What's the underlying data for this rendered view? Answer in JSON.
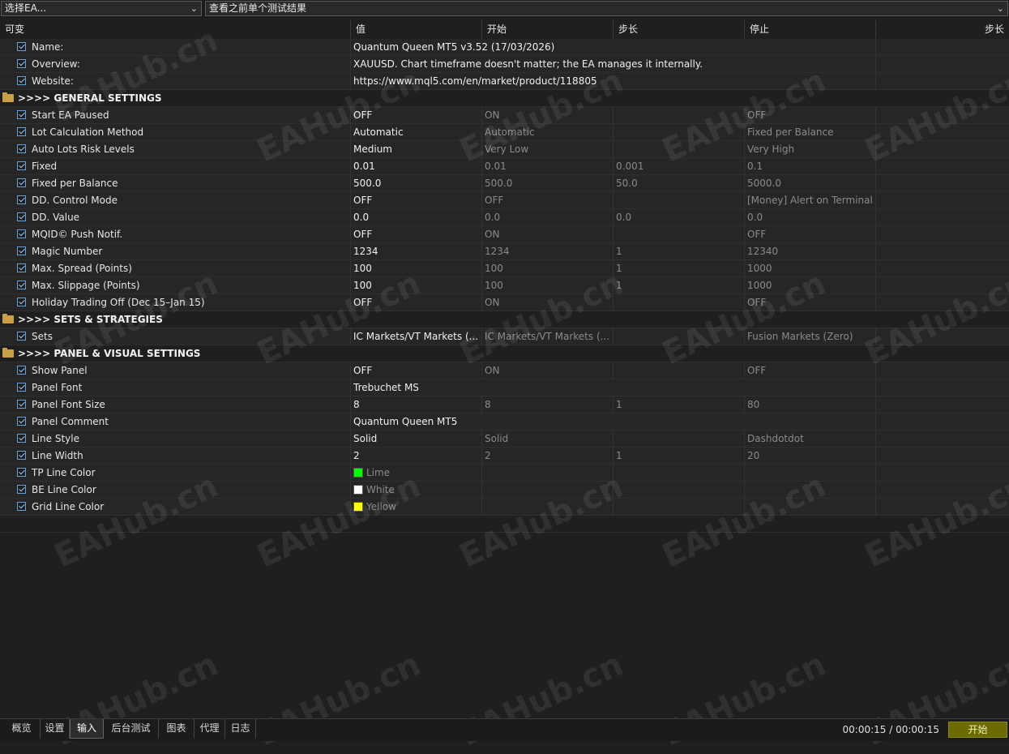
{
  "toolbar": {
    "ea_select": "选择EA...",
    "results_select": "查看之前单个测试结果"
  },
  "columns": [
    "可变",
    "值",
    "开始",
    "步长",
    "停止",
    "步长"
  ],
  "rows": [
    {
      "type": "param",
      "name": "Name:",
      "wide": "Quantum Queen MT5 v3.52 (17/03/2026)"
    },
    {
      "type": "param",
      "name": "Overview:",
      "wide": "XAUUSD. Chart timeframe doesn't matter; the EA manages it internally."
    },
    {
      "type": "param",
      "name": "Website:",
      "wide": "https://www.mql5.com/en/market/product/118805"
    },
    {
      "type": "section",
      "name": ">>>> GENERAL SETTINGS"
    },
    {
      "type": "param",
      "name": "Start EA Paused",
      "value": "OFF",
      "start": "ON",
      "step": "",
      "stop": "OFF"
    },
    {
      "type": "param",
      "name": "Lot Calculation Method",
      "value": "Automatic",
      "start": "Automatic",
      "step": "",
      "stop": "Fixed per Balance"
    },
    {
      "type": "param",
      "name": "Auto Lots Risk Levels",
      "value": "Medium",
      "start": "Very Low",
      "step": "",
      "stop": "Very High"
    },
    {
      "type": "param",
      "name": "Fixed",
      "value": "0.01",
      "start": "0.01",
      "step": "0.001",
      "stop": "0.1"
    },
    {
      "type": "param",
      "name": "Fixed per Balance",
      "value": "500.0",
      "start": "500.0",
      "step": "50.0",
      "stop": "5000.0"
    },
    {
      "type": "param",
      "name": "DD. Control Mode",
      "value": "OFF",
      "start": "OFF",
      "step": "",
      "stop": "[Money] Alert on Terminal"
    },
    {
      "type": "param",
      "name": "DD. Value",
      "value": "0.0",
      "start": "0.0",
      "step": "0.0",
      "stop": "0.0"
    },
    {
      "type": "param",
      "name": "MQID© Push Notif.",
      "value": "OFF",
      "start": "ON",
      "step": "",
      "stop": "OFF"
    },
    {
      "type": "param",
      "name": "Magic Number",
      "value": "1234",
      "start": "1234",
      "step": "1",
      "stop": "12340"
    },
    {
      "type": "param",
      "name": "Max. Spread (Points)",
      "value": "100",
      "start": "100",
      "step": "1",
      "stop": "1000"
    },
    {
      "type": "param",
      "name": "Max. Slippage (Points)",
      "value": "100",
      "start": "100",
      "step": "1",
      "stop": "1000"
    },
    {
      "type": "param",
      "name": "Holiday Trading Off (Dec 15–Jan 15)",
      "value": "OFF",
      "start": "ON",
      "step": "",
      "stop": "OFF"
    },
    {
      "type": "section",
      "name": ">>>> SETS & STRATEGIES"
    },
    {
      "type": "param",
      "name": "Sets",
      "value": "IC Markets/VT Markets (...",
      "start": "IC Markets/VT Markets (...",
      "step": "",
      "stop": "Fusion Markets (Zero)"
    },
    {
      "type": "section",
      "name": ">>>> PANEL & VISUAL SETTINGS"
    },
    {
      "type": "param",
      "name": "Show Panel",
      "value": "OFF",
      "start": "ON",
      "step": "",
      "stop": "OFF"
    },
    {
      "type": "param",
      "name": "Panel Font",
      "wide": "Trebuchet MS"
    },
    {
      "type": "param",
      "name": "Panel Font Size",
      "value": "8",
      "start": "8",
      "step": "1",
      "stop": "80"
    },
    {
      "type": "param",
      "name": "Panel Comment",
      "wide": "Quantum Queen MT5"
    },
    {
      "type": "param",
      "name": "Line Style",
      "value": "Solid",
      "start": "Solid",
      "step": "",
      "stop": "Dashdotdot"
    },
    {
      "type": "param",
      "name": "Line Width",
      "value": "2",
      "start": "2",
      "step": "1",
      "stop": "20"
    },
    {
      "type": "color",
      "name": "TP Line Color",
      "color_name": "Lime",
      "color": "#00ff00"
    },
    {
      "type": "color",
      "name": "BE Line Color",
      "color_name": "White",
      "color": "#ffffff"
    },
    {
      "type": "color",
      "name": "Grid Line Color",
      "color_name": "Yellow",
      "color": "#ffff00"
    }
  ],
  "watermark": "EAHub.cn",
  "tabs": [
    "概览",
    "设置",
    "输入",
    "后台测试",
    "图表",
    "代理",
    "日志"
  ],
  "active_tab": "输入",
  "timer": "00:00:15 / 00:00:15",
  "start_button": "开始"
}
